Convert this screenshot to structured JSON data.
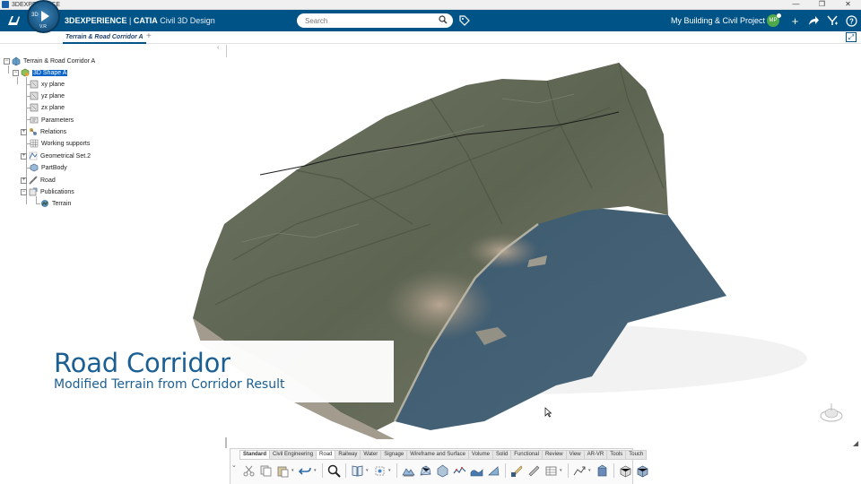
{
  "os": {
    "title": "3DEXPERIENCE",
    "controls": [
      "—",
      "❐",
      "✕"
    ]
  },
  "app": {
    "brand_bold": "3DEXPERIENCE",
    "brand_sep": " | ",
    "brand_app": "CATIA",
    "brand_role": " Civil 3D Design",
    "compass_version": "V.R",
    "compass_label": "3D"
  },
  "search": {
    "placeholder": "Search"
  },
  "project": {
    "label": "My Building & Civil Project",
    "caret": "⌄"
  },
  "user": {
    "initials": "MP"
  },
  "top_icons": [
    "plus-icon",
    "share-icon",
    "tools-icon",
    "help-icon"
  ],
  "tabs": {
    "active": "Terrain & Road Corridor A",
    "add": "+"
  },
  "tree": {
    "collapse": "‹",
    "root": "Terrain & Road Corridor A",
    "shape": "3D Shape A",
    "items": [
      {
        "label": "xy plane"
      },
      {
        "label": "yz plane"
      },
      {
        "label": "zx plane"
      },
      {
        "label": "Parameters"
      },
      {
        "label": "Relations"
      },
      {
        "label": "Working supports"
      },
      {
        "label": "Geometrical Set.2"
      },
      {
        "label": "PartBody"
      },
      {
        "label": "Road"
      },
      {
        "label": "Publications"
      },
      {
        "label": "Terrain"
      }
    ]
  },
  "overlay": {
    "title": "Road Corridor",
    "subtitle": "Modified Terrain from Corridor Result"
  },
  "action_bar": {
    "tabs": [
      "Standard",
      "Civil Engineering",
      "Road",
      "Railway",
      "Water",
      "Signage",
      "Wireframe and Surface",
      "Volume",
      "Solid",
      "Functional",
      "Review",
      "View",
      "AR-VR",
      "Tools",
      "Touch"
    ],
    "active_tab": "Standard",
    "toggle": "⌄"
  },
  "colors": {
    "app_bar": "#005386",
    "accent_text": "#1b5f93",
    "selection": "#0a64c8"
  }
}
